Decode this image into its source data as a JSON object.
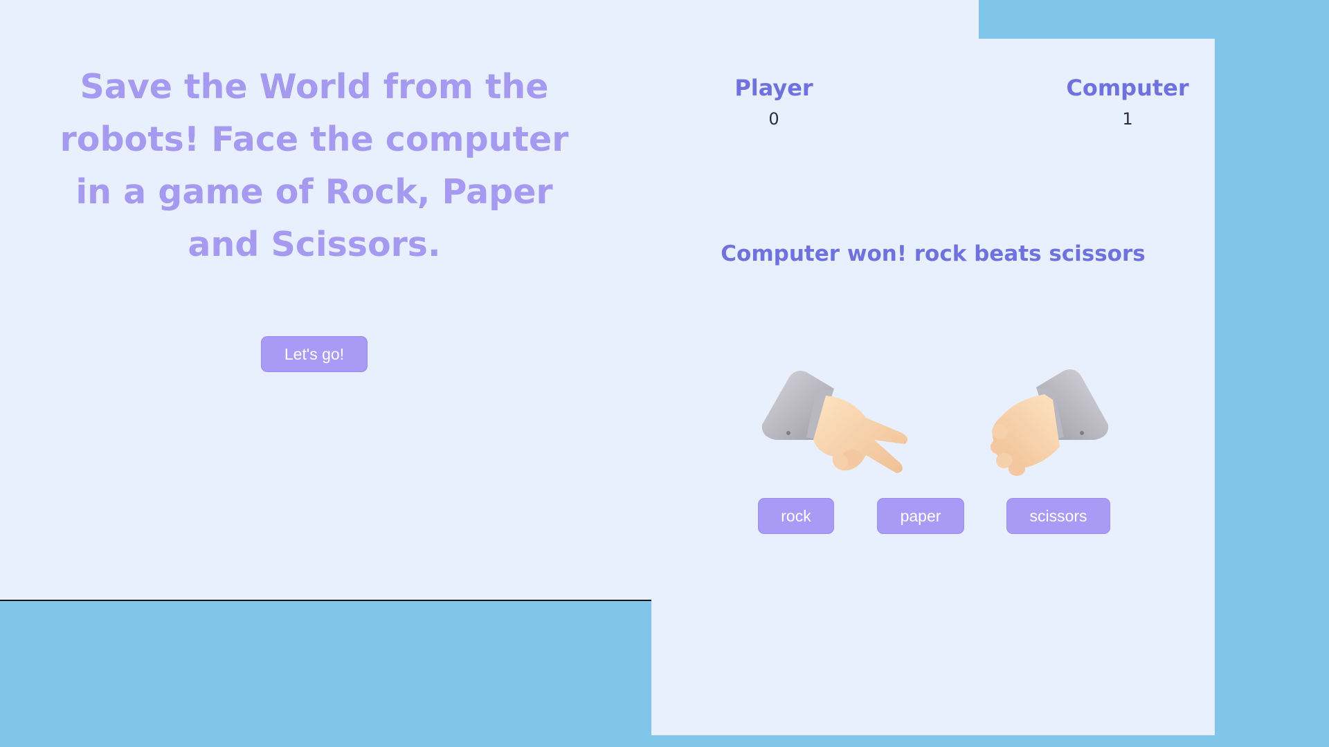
{
  "intro": {
    "title": "Save the World from the robots! Face the computer in a game of Rock, Paper and Scissors.",
    "start_button_label": "Let's go!"
  },
  "scoreboard": {
    "player": {
      "label": "Player",
      "score": "0"
    },
    "computer": {
      "label": "Computer",
      "score": "1"
    }
  },
  "result": {
    "message": "Computer won! rock beats scissors"
  },
  "hands": {
    "player_choice": "scissors",
    "computer_choice": "rock",
    "player_icon": "scissors-hand-icon",
    "computer_icon": "rock-fist-icon"
  },
  "choices": {
    "rock_label": "rock",
    "paper_label": "paper",
    "scissors_label": "scissors"
  },
  "colors": {
    "page_background": "#80c6ea",
    "panel_background": "#e8effd",
    "accent_text": "#6f72de",
    "intro_text": "#a59af0",
    "button": "#a99af5"
  }
}
